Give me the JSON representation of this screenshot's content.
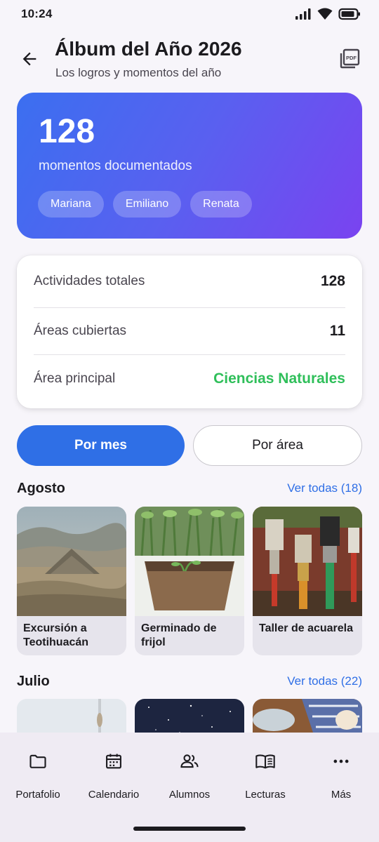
{
  "status": {
    "time": "10:24"
  },
  "header": {
    "title": "Álbum del Año 2026",
    "subtitle": "Los logros y momentos del año",
    "back_icon": "arrow-left-icon",
    "pdf_icon": "pdf-export-icon"
  },
  "hero": {
    "count": "128",
    "label": "momentos documentados",
    "students": [
      "Mariana",
      "Emiliano",
      "Renata"
    ],
    "gradient": [
      "#3b6ff0",
      "#7a43f0"
    ]
  },
  "stats": [
    {
      "label": "Actividades totales",
      "value": "128"
    },
    {
      "label": "Áreas cubiertas",
      "value": "11"
    },
    {
      "label": "Área principal",
      "value": "Ciencias Naturales",
      "color": "#2fbf5a"
    }
  ],
  "view_toggle": {
    "active": "Por mes",
    "inactive": "Por área"
  },
  "sections": [
    {
      "title": "Agosto",
      "link": "Ver todas (18)",
      "cards": [
        {
          "caption": "Excursión a Teotihuacán",
          "image": "pyramid-landscape"
        },
        {
          "caption": "Germinado de frijol",
          "image": "seedling-pot"
        },
        {
          "caption": "Taller de acuarela",
          "image": "paint-brushes"
        }
      ]
    },
    {
      "title": "Julio",
      "link": "Ver todas (22)",
      "cards": [
        {
          "image": "light-window"
        },
        {
          "image": "night-sky"
        },
        {
          "image": "kitchen-eggs"
        }
      ]
    }
  ],
  "nav": [
    {
      "label": "Portafolio",
      "icon": "folder-icon"
    },
    {
      "label": "Calendario",
      "icon": "calendar-icon"
    },
    {
      "label": "Alumnos",
      "icon": "people-icon"
    },
    {
      "label": "Lecturas",
      "icon": "book-icon"
    },
    {
      "label": "Más",
      "icon": "more-icon"
    }
  ],
  "colors": {
    "primary": "#2f6fe6",
    "accent_green": "#2fbf5a",
    "nav_bg": "#efebf3"
  }
}
